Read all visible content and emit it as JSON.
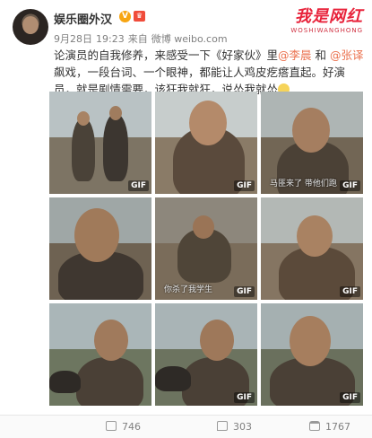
{
  "user": {
    "name": "娱乐圈外汉",
    "verified_badge": "V",
    "vip_badge": "♛"
  },
  "meta": {
    "date": "9月28日",
    "time": "19:23",
    "source_prefix": "来自",
    "source": "微博 weibo.com"
  },
  "watermark": {
    "main": "我是网红",
    "sub": "WOSHIWANGHONG"
  },
  "post": {
    "part1": "论演员的自我修养，来感受一下《好家伙》里",
    "mention1": "@李晨",
    "part2": " 和 ",
    "mention2": "@张译",
    "part3": " 飙戏，一段台词、一个眼神，都能让人鸡皮疙瘩直起。好演员，就是剧情需要，该狂我就狂，说怂我就怂"
  },
  "images": [
    {
      "gif": "GIF",
      "subtitle": ""
    },
    {
      "gif": "GIF",
      "subtitle": ""
    },
    {
      "gif": "GIF",
      "subtitle": "马匪来了 带他们跑"
    },
    {
      "gif": "",
      "subtitle": ""
    },
    {
      "gif": "GIF",
      "subtitle": "你杀了我学生"
    },
    {
      "gif": "GIF",
      "subtitle": ""
    },
    {
      "gif": "",
      "subtitle": ""
    },
    {
      "gif": "GIF",
      "subtitle": ""
    },
    {
      "gif": "GIF",
      "subtitle": ""
    }
  ],
  "actions": {
    "repost_count": "746",
    "comment_count": "303",
    "like_count": "1767"
  }
}
